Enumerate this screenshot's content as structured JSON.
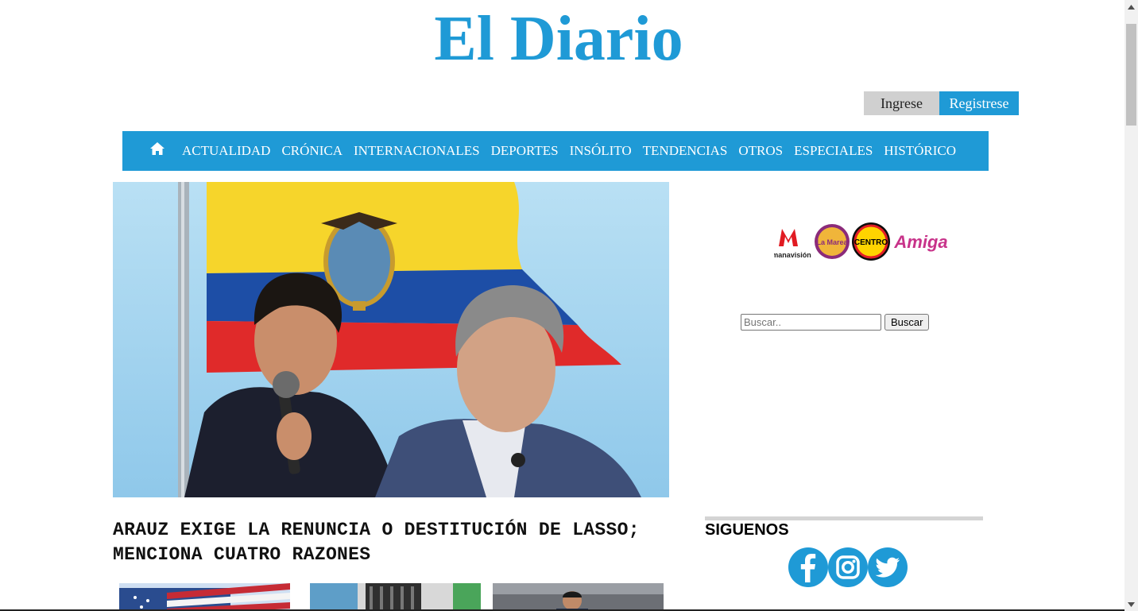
{
  "site": {
    "logo": "El Diario",
    "accent_color": "#1f9ad6"
  },
  "auth": {
    "login_label": "Ingrese",
    "register_label": "Registrese"
  },
  "nav": {
    "home_icon": "home-icon",
    "items": [
      "ACTUALIDAD",
      "CRÓNICA",
      "INTERNACIONALES",
      "DEPORTES",
      "INSÓLITO",
      "TENDENCIAS",
      "OTROS",
      "ESPECIALES",
      "HISTÓRICO"
    ]
  },
  "main": {
    "headline": "ARAUZ EXIGE LA RENUNCIA O DESTITUCIÓN DE LASSO; MENCIONA CUATRO RAZONES"
  },
  "sidebar": {
    "radio_logos": [
      "manavisión",
      "La Marea",
      "CENTRO",
      "Amiga"
    ],
    "search": {
      "placeholder": "Buscar..",
      "button_label": "Buscar"
    },
    "follow": {
      "title": "SIGUENOS",
      "icons": [
        "facebook-icon",
        "instagram-icon",
        "twitter-icon"
      ]
    }
  }
}
